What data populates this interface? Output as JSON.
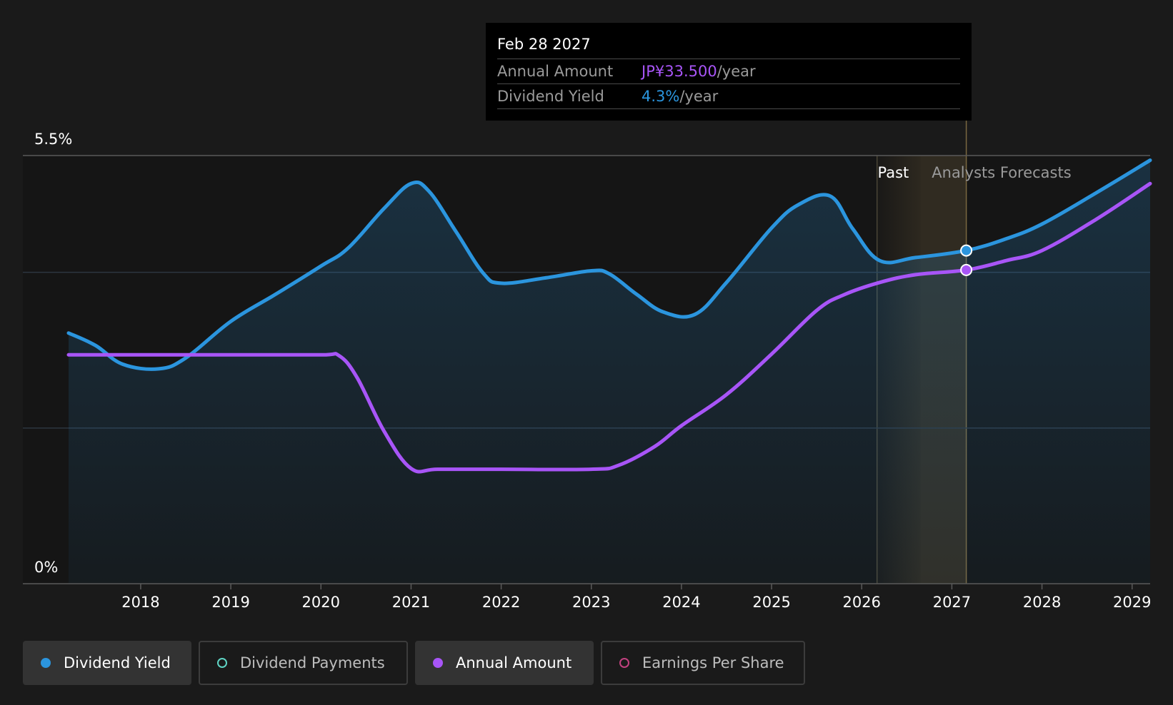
{
  "tooltip": {
    "date": "Feb 28 2027",
    "rows": [
      {
        "label": "Annual Amount",
        "value": "JP¥33.500",
        "unit": "/year",
        "color": "#a855f7"
      },
      {
        "label": "Dividend Yield",
        "value": "4.3%",
        "unit": "/year",
        "color": "#2b95de"
      }
    ]
  },
  "regions": {
    "past_label": "Past",
    "forecast_label": "Analysts Forecasts"
  },
  "legend": [
    {
      "label": "Dividend Yield",
      "active": true,
      "color": "#2b95de",
      "marker": "filled-dot-icon"
    },
    {
      "label": "Dividend Payments",
      "active": false,
      "color": "#5fd4c4",
      "marker": "hollow-dot-icon"
    },
    {
      "label": "Annual Amount",
      "active": true,
      "color": "#a855f7",
      "marker": "filled-dot-icon"
    },
    {
      "label": "Earnings Per Share",
      "active": false,
      "color": "#c2417f",
      "marker": "hollow-dot-icon"
    }
  ],
  "chart_data": {
    "type": "line",
    "y_tick_labels": [
      "5.5%",
      "0%"
    ],
    "ylim": [
      0,
      5.5
    ],
    "xlim": [
      2017.2,
      2029.2
    ],
    "x_ticks": [
      2018,
      2019,
      2020,
      2021,
      2022,
      2023,
      2024,
      2025,
      2026,
      2027,
      2028,
      2029
    ],
    "past_end": 2026.17,
    "forecast_start": 2026.65,
    "highlight_x": 2027.16,
    "series": [
      {
        "name": "Dividend Yield",
        "color": "#2b95de",
        "area": true,
        "points": [
          [
            2017.2,
            3.22
          ],
          [
            2017.5,
            3.06
          ],
          [
            2017.8,
            2.82
          ],
          [
            2018.2,
            2.76
          ],
          [
            2018.5,
            2.9
          ],
          [
            2019.0,
            3.37
          ],
          [
            2019.5,
            3.72
          ],
          [
            2020.0,
            4.08
          ],
          [
            2020.3,
            4.31
          ],
          [
            2020.7,
            4.82
          ],
          [
            2021.0,
            5.14
          ],
          [
            2021.2,
            5.04
          ],
          [
            2021.5,
            4.52
          ],
          [
            2021.8,
            3.99
          ],
          [
            2022.0,
            3.86
          ],
          [
            2022.5,
            3.93
          ],
          [
            2023.0,
            4.02
          ],
          [
            2023.2,
            3.98
          ],
          [
            2023.5,
            3.72
          ],
          [
            2023.8,
            3.49
          ],
          [
            2024.15,
            3.46
          ],
          [
            2024.5,
            3.87
          ],
          [
            2025.0,
            4.57
          ],
          [
            2025.3,
            4.87
          ],
          [
            2025.65,
            4.98
          ],
          [
            2025.9,
            4.56
          ],
          [
            2026.2,
            4.15
          ],
          [
            2026.6,
            4.19
          ],
          [
            2027.16,
            4.28
          ],
          [
            2027.6,
            4.43
          ],
          [
            2028.0,
            4.62
          ],
          [
            2028.6,
            5.02
          ],
          [
            2029.2,
            5.44
          ]
        ]
      },
      {
        "name": "Annual Amount",
        "color": "#a855f7",
        "area": false,
        "points": [
          [
            2017.2,
            2.94
          ],
          [
            2018.0,
            2.94
          ],
          [
            2019.0,
            2.94
          ],
          [
            2020.0,
            2.94
          ],
          [
            2020.2,
            2.93
          ],
          [
            2020.4,
            2.65
          ],
          [
            2020.7,
            1.96
          ],
          [
            2021.0,
            1.48
          ],
          [
            2021.3,
            1.47
          ],
          [
            2022.0,
            1.47
          ],
          [
            2023.0,
            1.47
          ],
          [
            2023.3,
            1.52
          ],
          [
            2023.7,
            1.76
          ],
          [
            2024.0,
            2.03
          ],
          [
            2024.5,
            2.43
          ],
          [
            2025.0,
            2.95
          ],
          [
            2025.5,
            3.51
          ],
          [
            2025.8,
            3.71
          ],
          [
            2026.2,
            3.87
          ],
          [
            2026.6,
            3.97
          ],
          [
            2027.16,
            4.03
          ],
          [
            2027.6,
            4.15
          ],
          [
            2028.0,
            4.28
          ],
          [
            2028.6,
            4.68
          ],
          [
            2029.2,
            5.14
          ]
        ]
      }
    ],
    "highlight_points": [
      {
        "series": "Dividend Yield",
        "x": 2027.16,
        "y": 4.28
      },
      {
        "series": "Annual Amount",
        "x": 2027.16,
        "y": 4.03
      }
    ]
  }
}
